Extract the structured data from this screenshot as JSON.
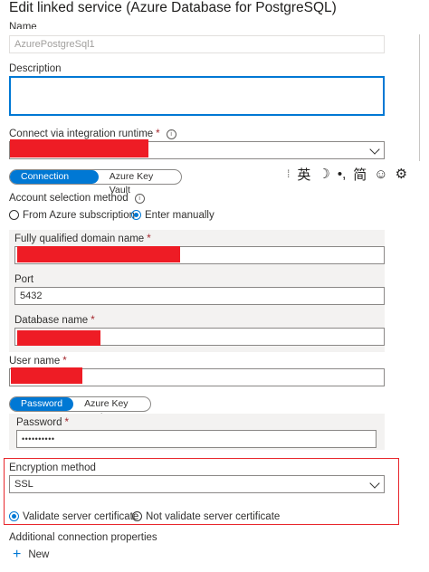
{
  "header": {
    "title": "Edit linked service (Azure Database for PostgreSQL)"
  },
  "name_field": {
    "label": "Name",
    "value": "AzurePostgreSql1"
  },
  "description": {
    "label": "Description",
    "value": ""
  },
  "integration_runtime": {
    "label": "Connect via integration runtime",
    "required_mark": "*",
    "info_icon": "i"
  },
  "connection_tabs": {
    "active": "Connection string",
    "inactive": "Azure Key Vault"
  },
  "ime_toolbar": {
    "items": [
      "英",
      "☽",
      "•,",
      "简",
      "☺",
      "⚙"
    ],
    "separator": "⁞"
  },
  "account_selection": {
    "label": "Account selection method",
    "info_icon": "i",
    "options": [
      "From Azure subscription",
      "Enter manually"
    ],
    "selected": "Enter manually"
  },
  "fqdn": {
    "label": "Fully qualified domain name",
    "required_mark": "*"
  },
  "port": {
    "label": "Port",
    "value": "5432"
  },
  "database_name": {
    "label": "Database name",
    "required_mark": "*"
  },
  "user_name": {
    "label": "User name",
    "required_mark": "*"
  },
  "password_tabs": {
    "active": "Password",
    "inactive": "Azure Key Vault"
  },
  "password": {
    "label": "Password",
    "required_mark": "*",
    "value": "••••••••••"
  },
  "encryption": {
    "label": "Encryption method",
    "value": "SSL",
    "options": [
      "Validate server certificate",
      "Not validate server certificate"
    ],
    "selected": "Validate server certificate",
    "highlight_color": "#e8262c"
  },
  "additional_props": {
    "label": "Additional connection properties",
    "new_label": "New",
    "plus_icon": "+"
  },
  "colors": {
    "accent": "#0078d4",
    "redaction": "#ee1c25"
  }
}
